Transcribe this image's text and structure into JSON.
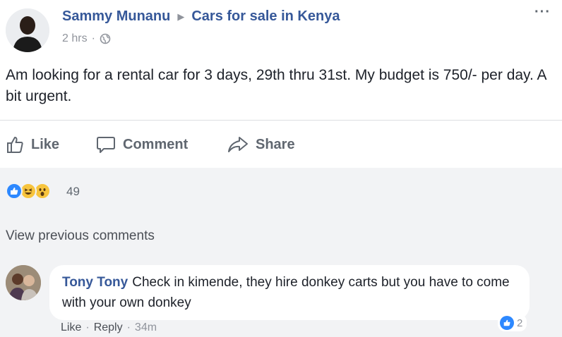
{
  "post": {
    "author": "Sammy Munanu",
    "group": "Cars for sale in Kenya",
    "time": "2 hrs",
    "body": "Am looking for a rental car for 3 days, 29th thru 31st. My budget is 750/- per day. A bit urgent."
  },
  "actions": {
    "like": "Like",
    "comment": "Comment",
    "share": "Share"
  },
  "reactions": {
    "icons": [
      "like-reaction-icon",
      "haha-reaction-icon",
      "wow-reaction-icon"
    ],
    "count": "49"
  },
  "comments": {
    "view_previous": "View previous comments",
    "items": [
      {
        "author": "Tony Tony",
        "text": "Check in kimende, they hire donkey carts but you have to come with your own donkey",
        "like_label": "Like",
        "reply_label": "Reply",
        "time": "34m",
        "reaction_count": "2"
      }
    ]
  },
  "colors": {
    "link_blue": "#365899",
    "muted": "#90949c",
    "action_gray": "#606770",
    "like_blue": "#2d88ff",
    "background_gray": "#f2f3f5"
  }
}
